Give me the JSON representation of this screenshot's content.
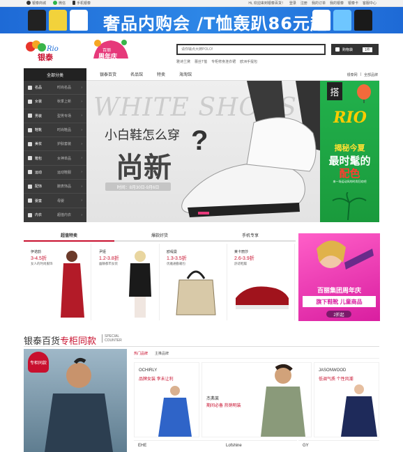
{
  "topbar": {
    "left": [
      "银泰商城",
      "微信",
      "手机银泰"
    ],
    "right": [
      "Hi, 欢迎来到银泰百货！",
      "登录",
      "注册",
      "我的订单",
      "我的银泰",
      "银泰卡",
      "客服中心"
    ]
  },
  "banner": {
    "text": "奢品内购会 /T恤轰趴86元起"
  },
  "logo": {
    "main": "银泰",
    "brand2_top": "百货",
    "brand2": "周年庆"
  },
  "search": {
    "placeholder": "请你输点大牌POLO!"
  },
  "cart": {
    "label": "购物袋",
    "count": "1件"
  },
  "hot_keywords": [
    "雅诗兰黛",
    "蕾丝T恤",
    "专柜修身连衣裙",
    "欧洲手提包"
  ],
  "nav": {
    "category_button": "全部分类",
    "items": [
      "银泰百货",
      "名品馆",
      "特卖",
      "海淘馆"
    ],
    "right": [
      "银泰网",
      "全部品牌"
    ]
  },
  "sidebar": [
    {
      "label": "名品",
      "sub": "时尚名品"
    },
    {
      "label": "女装",
      "sub": "秋季上新"
    },
    {
      "label": "男装",
      "sub": "型男专场"
    },
    {
      "label": "鞋靴",
      "sub": "时尚鞋品"
    },
    {
      "label": "美妆",
      "sub": "护肤套装"
    },
    {
      "label": "箱包",
      "sub": "女神单品"
    },
    {
      "label": "运动",
      "sub": "运动鞋服"
    },
    {
      "label": "配饰",
      "sub": "腕表饰品"
    },
    {
      "label": "婴童",
      "sub": "母婴"
    },
    {
      "label": "内衣",
      "sub": "超值内衣"
    }
  ],
  "hero": {
    "watermark": "WHITE SHOES",
    "line1": "小白鞋怎么穿",
    "line2": "尚新",
    "date": "时间：8月30日-9月6日"
  },
  "promo": {
    "tag": "搭",
    "rio": "RIO",
    "line1": "揭秘今夏",
    "line2": "最时髦的",
    "line3": "配色",
    "line4": "来一场运动风的时尚狂欢吧"
  },
  "sale": {
    "tabs": [
      "超值特卖",
      "爆款好货",
      "手机专享"
    ],
    "cards": [
      {
        "name": "伊诺韵",
        "disc": "3-4.5折",
        "sub": "女人的时尚服饰"
      },
      {
        "name": "尹娅",
        "disc": "1.2-3.8折",
        "sub": "幽静都市女装"
      },
      {
        "name": "欧缇曼",
        "disc": "1.3-3.5折",
        "sub": "优雅通勤箱包"
      },
      {
        "name": "莱卡丽莎",
        "disc": "2.6-3.9折",
        "sub": "舒适鞋履"
      }
    ],
    "pink": {
      "line1": "百丽集团周年庆",
      "line2": "旗下鞋靴 儿童商品",
      "line3": "2折起"
    }
  },
  "brand_counter": {
    "title_plain": "银泰百货",
    "title_red": "专柜同款",
    "sub1": "SPECIAL",
    "sub2": "COUNTER",
    "badge": "专柜同款",
    "tabs": [
      "热门品牌",
      "主推品牌"
    ],
    "brands": [
      {
        "name": "OCHIRLY",
        "desc": "品牌女装 李未让利"
      },
      {
        "name": "杰弗莱",
        "desc": "期间必备 热销明装"
      },
      {
        "name": "JASONWOOD",
        "desc": "低调气质 个性风潮"
      }
    ],
    "brands2": [
      "EHE",
      "Lofshine",
      "GY"
    ]
  },
  "colors": {
    "accent": "#c8102e",
    "banner": "#2d86e6",
    "promo_green": "#22b14c",
    "promo_pink": "#e33ab2"
  }
}
